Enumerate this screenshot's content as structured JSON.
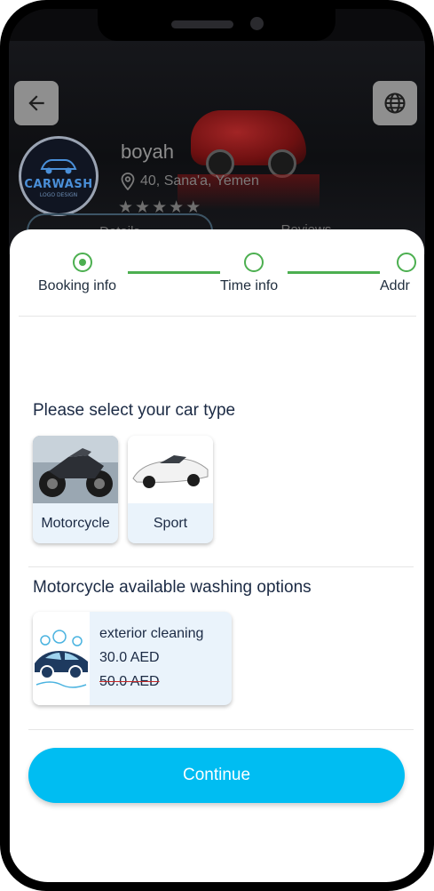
{
  "header": {
    "shop_name": "boyah",
    "location": "40, Sana'a, Yemen",
    "rating_stars": 5,
    "rating_filled": 0,
    "logo_text": "CARWASH",
    "logo_subtext": "LOGO DESIGN",
    "tabs": [
      "Details",
      "Reviews"
    ]
  },
  "stepper": {
    "steps": [
      "Booking info",
      "Time info",
      "Addr"
    ],
    "active_index": 0
  },
  "car_type": {
    "title": "Please select your car type",
    "options": [
      {
        "label": "Motorcycle"
      },
      {
        "label": "Sport"
      }
    ]
  },
  "washing": {
    "title": "Motorcycle available washing options",
    "options": [
      {
        "name": "exterior cleaning",
        "price": "30.0 AED",
        "old_price": "50.0 AED"
      }
    ]
  },
  "actions": {
    "continue_label": "Continue"
  },
  "colors": {
    "accent": "#00bdf2",
    "step_green": "#4caf50",
    "text_dark": "#1b2a44",
    "card_bg": "#eaf3fb"
  }
}
